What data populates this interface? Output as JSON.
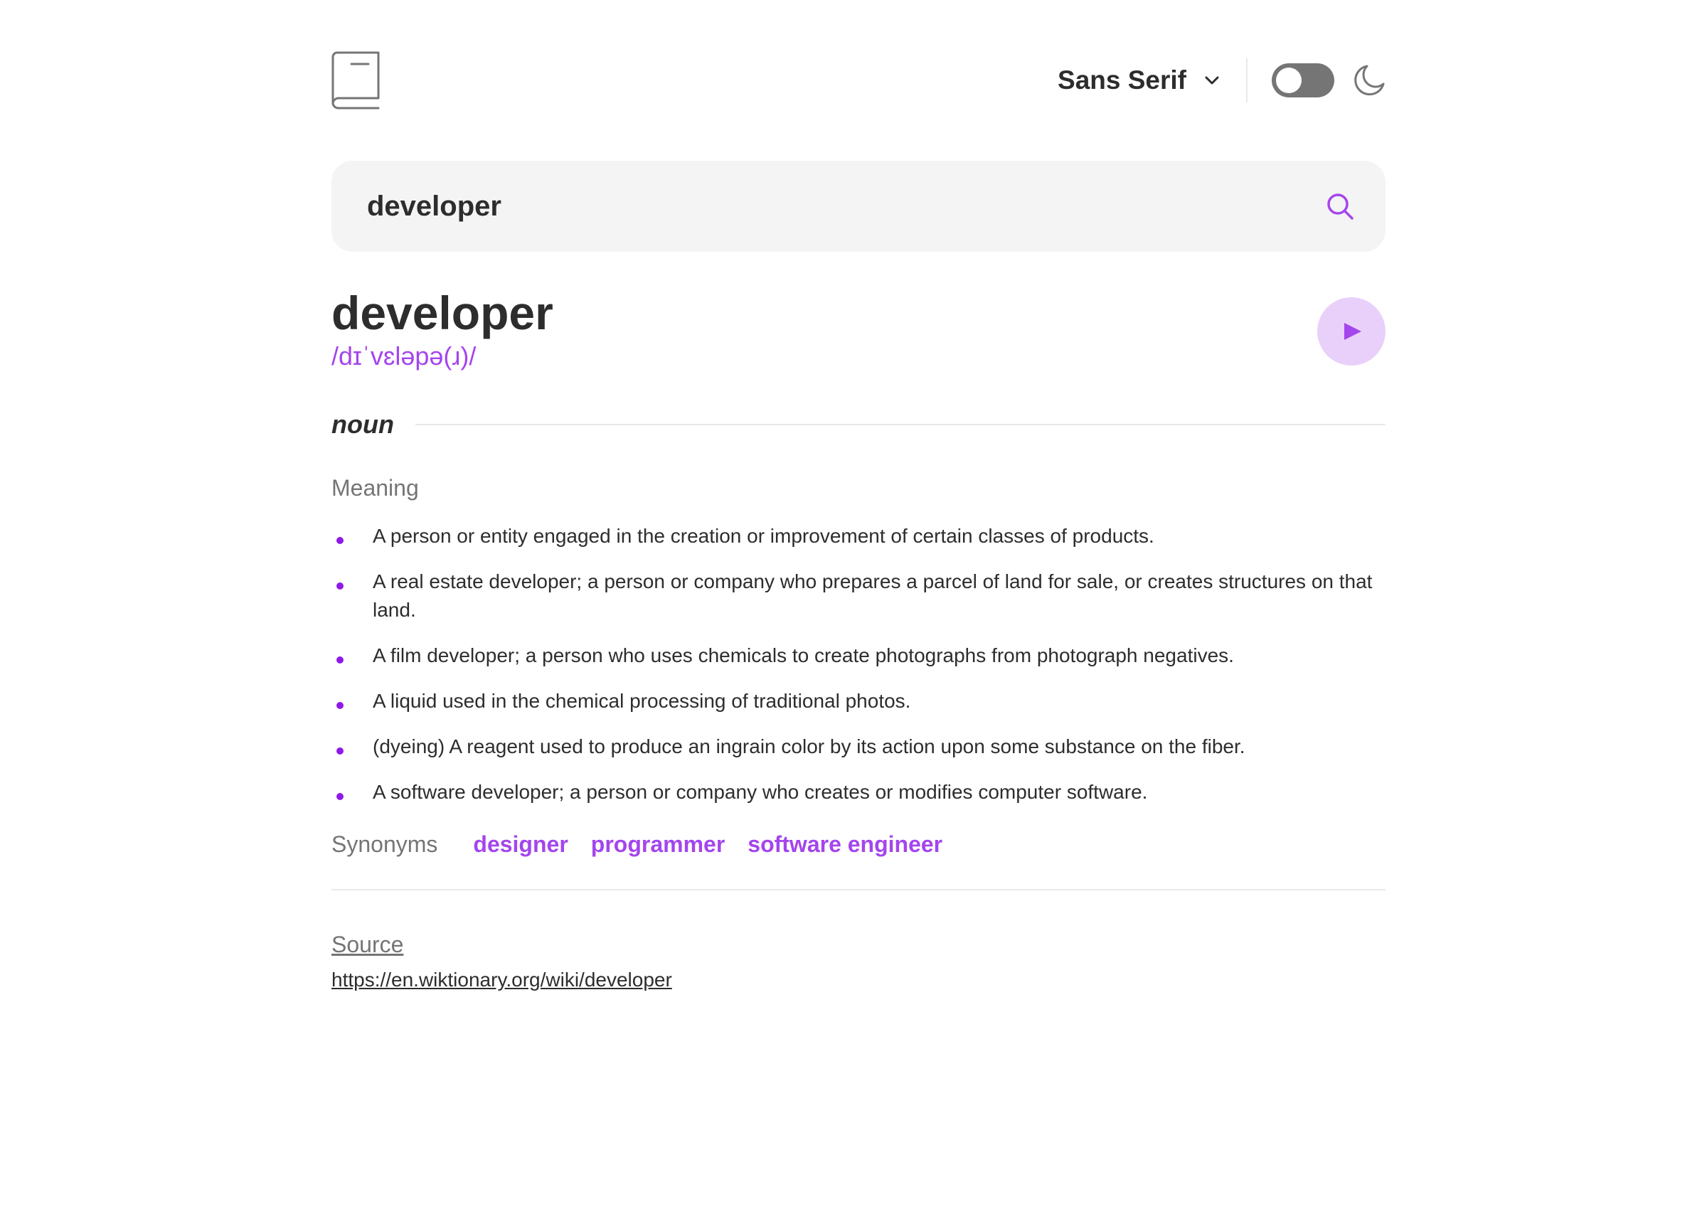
{
  "header": {
    "logo_icon": "book-icon",
    "font_selector": {
      "selected": "Sans Serif",
      "icon": "chevron-down-icon"
    },
    "theme_toggle": {
      "state": "off",
      "icon": "moon-icon"
    }
  },
  "search": {
    "value": "developer",
    "icon": "search-icon"
  },
  "entry": {
    "word": "developer",
    "phonetic": "/dɪˈvɛləpə(ɹ)/",
    "play_icon": "play-icon",
    "part_of_speech": "noun",
    "meaning_title": "Meaning",
    "definitions": [
      "A person or entity engaged in the creation or improvement of certain classes of products.",
      "A real estate developer; a person or company who prepares a parcel of land for sale, or creates structures on that land.",
      "A film developer; a person who uses chemicals to create photographs from photograph negatives.",
      "A liquid used in the chemical processing of traditional photos.",
      "(dyeing) A reagent used to produce an ingrain color by its action upon some substance on the fiber.",
      "A software developer; a person or company who creates or modifies computer software."
    ],
    "synonyms_label": "Synonyms",
    "synonyms": [
      "designer",
      "programmer",
      "software engineer"
    ]
  },
  "source": {
    "label": "Source",
    "url": "https://en.wiktionary.org/wiki/developer"
  },
  "colors": {
    "accent": "#a445ed",
    "text": "#2d2d2d",
    "muted": "#757575",
    "search_bg": "#f4f4f4",
    "play_bg": "#e9d0fa",
    "toggle_bg": "#757575"
  }
}
